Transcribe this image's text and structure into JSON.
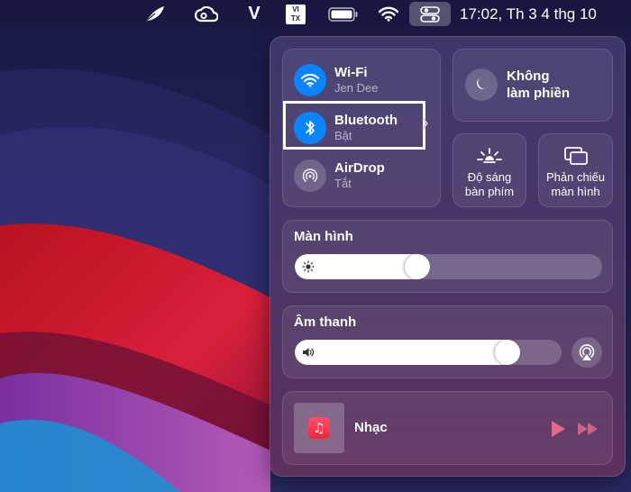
{
  "menubar": {
    "icons": [
      "feather-icon",
      "creative-cloud-icon",
      "v-app-icon",
      "vietnamese-input-icon",
      "battery-icon",
      "wifi-icon",
      "control-center-icon"
    ],
    "v_label": "V",
    "vitx_top": "VI",
    "vitx_bottom": "TX",
    "clock": "17:02, Th 3 4 thg 10"
  },
  "control_center": {
    "connectivity": [
      {
        "title": "Wi-Fi",
        "subtitle": "Jen Dee",
        "state": "on",
        "icon": "wifi-icon"
      },
      {
        "title": "Bluetooth",
        "subtitle": "Bật",
        "state": "on",
        "icon": "bluetooth-icon"
      },
      {
        "title": "AirDrop",
        "subtitle": "Tắt",
        "state": "off",
        "icon": "airdrop-icon"
      }
    ],
    "dnd": {
      "line1": "Không",
      "line2": "làm phiền",
      "icon": "moon-icon"
    },
    "keyboard_brightness": {
      "line1": "Độ sáng",
      "line2": "bàn phím",
      "icon": "keyboard-brightness-icon"
    },
    "screen_mirroring": {
      "line1": "Phản chiếu",
      "line2": "màn hình",
      "icon": "screen-mirroring-icon"
    },
    "display": {
      "label": "Màn hình",
      "level": 0.39,
      "icon": "sun-icon"
    },
    "sound": {
      "label": "Âm thanh",
      "level": 0.83,
      "icon": "speaker-icon"
    },
    "music": {
      "title": "Nhạc",
      "app_icon": "♫"
    }
  },
  "colors": {
    "accent_blue": "#0a84ff",
    "highlight": "#ffffff"
  }
}
